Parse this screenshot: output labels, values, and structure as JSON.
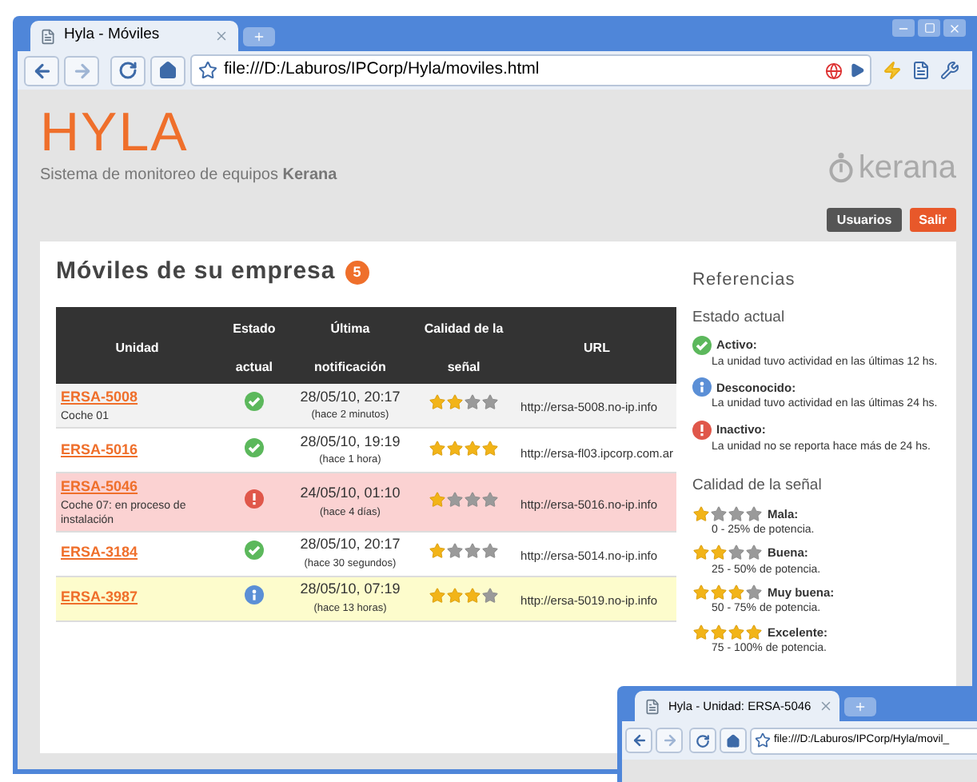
{
  "browser": {
    "tab": "Hyla - Móviles",
    "url": "file:///D:/Laburos/IPCorp/Hyla/moviles.html"
  },
  "header": {
    "logo": "HYLA",
    "tagline": "Sistema de monitoreo de equipos **Kerana**",
    "brand": "kerana",
    "buttons": [
      {
        "label": "Usuarios",
        "kind": "dark"
      },
      {
        "label": "Salir",
        "kind": "accent"
      }
    ]
  },
  "main": {
    "title": "Móviles de su empresa",
    "count": "5",
    "table": {
      "columns": [
        "Unidad",
        "Estado actual",
        "Última notificación",
        "Calidad de la señal",
        "URL"
      ],
      "rows": [
        {
          "unit": "ERSA-5008",
          "note": "Coche 01",
          "kind": "active",
          "date": "28/05/10, 20:17",
          "ago": "(hace 2 minutos)",
          "stars": 2,
          "url": "http://ersa-5008.no-ip.info"
        },
        {
          "unit": "ERSA-5016",
          "kind": "active",
          "date": "28/05/10, 19:19",
          "ago": "(hace 1 hora)",
          "stars": 4,
          "url": "http://ersa-fl03.ipcorp.com.ar"
        },
        {
          "unit": "ERSA-5046",
          "note": "Coche 07: en proceso de instalación",
          "kind": "inactive",
          "date": "24/05/10, 01:10",
          "ago": "(hace 4 días)",
          "stars": 1,
          "url": "http://ersa-5016.no-ip.info"
        },
        {
          "unit": "ERSA-3184",
          "kind": "active",
          "date": "28/05/10, 20:17",
          "ago": "(hace 30 segundos)",
          "stars": 1,
          "url": "http://ersa-5014.no-ip.info"
        },
        {
          "unit": "ERSA-3987",
          "kind": "unknown",
          "date": "28/05/10, 07:19",
          "ago": "(hace 13 horas)",
          "stars": 3,
          "url": "http://ersa-5019.no-ip.info"
        }
      ]
    }
  },
  "references": {
    "title": "Referencias",
    "status_title": "Estado actual",
    "statuses": [
      {
        "kind": "active",
        "label": "Activo:",
        "text": "La unidad tuvo actividad en las últimas 12 hs."
      },
      {
        "kind": "unknown",
        "label": "Desconocido:",
        "text": "La unidad tuvo actividad en las últimas 24 hs."
      },
      {
        "kind": "inactive",
        "label": "Inactivo:",
        "text": "La unidad no se reporta hace más de 24 hs."
      }
    ],
    "signal_title": "Calidad de la señal",
    "signals": [
      {
        "stars": 1,
        "label": "Mala:",
        "text": "0 - 25% de potencia."
      },
      {
        "stars": 2,
        "label": "Buena:",
        "text": "25 - 50% de potencia."
      },
      {
        "stars": 3,
        "label": "Muy buena:",
        "text": "50 - 75% de potencia."
      },
      {
        "stars": 4,
        "label": "Excelente:",
        "text": "75 - 100% de potencia."
      }
    ]
  },
  "second_window": {
    "tab": "Hyla - Unidad: ERSA-5046",
    "url": "file:///D:/Laburos/IPCorp/Hyla/movil_"
  }
}
